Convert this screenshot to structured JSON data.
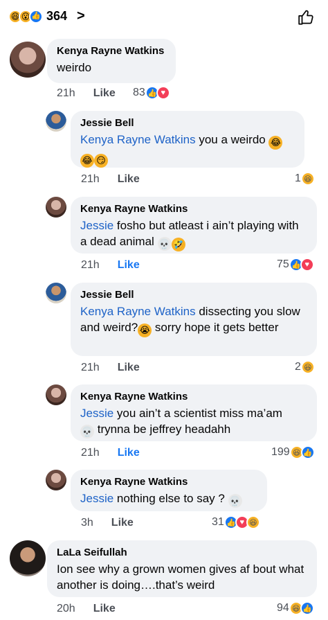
{
  "header": {
    "reaction_count": "364",
    "chevron": ">",
    "reaction_icons": [
      "haha-icon",
      "wow-icon",
      "like-icon"
    ]
  },
  "comments": [
    {
      "author": "Kenya Rayne Watkins",
      "text": "weirdo",
      "time": "21h",
      "like_label": "Like",
      "reactions": "83"
    },
    {
      "author": "Jessie Bell",
      "mention": "Kenya Rayne Watkins",
      "text": " you a weirdo",
      "time": "21h",
      "like_label": "Like",
      "reactions": "1"
    },
    {
      "author": "Kenya Rayne Watkins",
      "mention": "Jessie",
      "text": " fosho but atleast i ain’t playing with a dead animal",
      "time": "21h",
      "like_label": "Like",
      "reactions": "75"
    },
    {
      "author": "Jessie Bell",
      "mention": "Kenya Rayne Watkins",
      "text": " dissecting you slow and weird?",
      "text2": " sorry hope it gets better",
      "time": "21h",
      "like_label": "Like",
      "reactions": "2"
    },
    {
      "author": "Kenya Rayne Watkins",
      "mention": "Jessie",
      "text": " you ain’t a scientist miss ma’am",
      "text2": " trynna be jeffrey headahh",
      "time": "21h",
      "like_label": "Like",
      "reactions": "199"
    },
    {
      "author": "Kenya Rayne Watkins",
      "mention": "Jessie",
      "text": " nothing else to say ?",
      "time": "3h",
      "like_label": "Like",
      "reactions": "31"
    },
    {
      "author": "LaLa Seifullah",
      "text": "Ion see why a grown women gives af bout what another is doing….that’s weird",
      "time": "20h",
      "like_label": "Like",
      "reactions": "94"
    }
  ],
  "colors": {
    "bubble": "#f0f2f5",
    "mention": "#1d62c7",
    "like_active": "#1877f2",
    "love": "#f33e58",
    "haha": "#f7b125"
  }
}
